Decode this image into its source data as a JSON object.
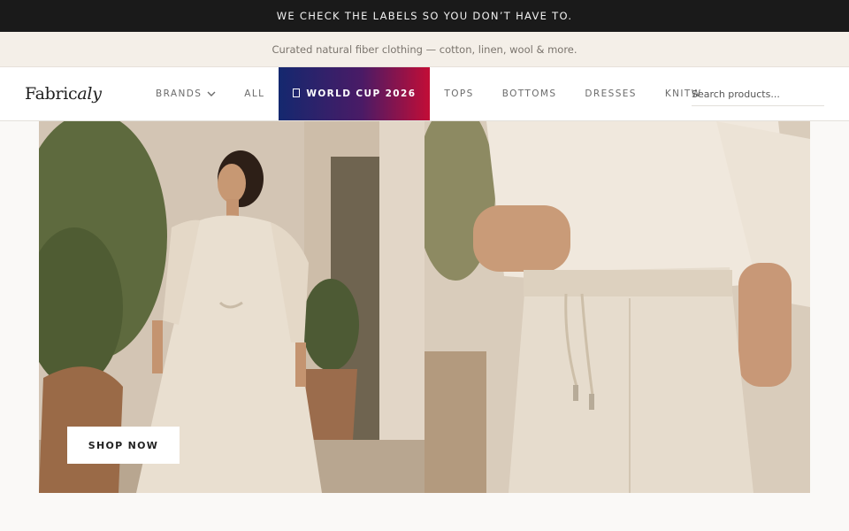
{
  "announcement": "WE CHECK THE LABELS SO YOU DON’T HAVE TO.",
  "tagline": "Curated natural fiber clothing — cotton, linen, wool & more.",
  "brand": {
    "logo_regular": "Fabric",
    "logo_italic": "aly"
  },
  "nav": {
    "items": [
      {
        "label": "BRANDS",
        "icon": "chevron-down-icon"
      },
      {
        "label": "ALL"
      },
      {
        "label": "WORLD CUP 2026",
        "icon": "flag-icon",
        "featured": true
      },
      {
        "label": "TOPS"
      },
      {
        "label": "BOTTOMS"
      },
      {
        "label": "DRESSES"
      },
      {
        "label": "KNITW"
      }
    ],
    "feature_colors": [
      "#14286f",
      "#4a1b66",
      "#c20d36"
    ]
  },
  "search": {
    "placeholder": "Search products..."
  },
  "hero": {
    "cta_label": "SHOP NOW"
  }
}
